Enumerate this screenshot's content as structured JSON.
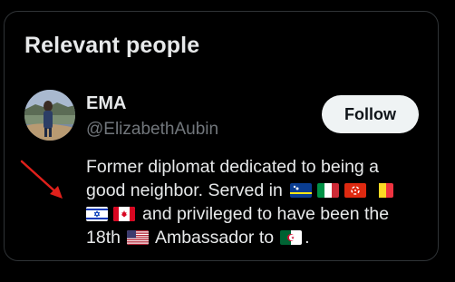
{
  "section": {
    "title": "Relevant people"
  },
  "person": {
    "name": "EMA",
    "handle": "@ElizabethAubin",
    "follow_label": "Follow",
    "avatar_icon": "profile-photo",
    "bio": {
      "line1": "Former diplomat dedicated to being a",
      "line2_text": "good neighbor. Served in",
      "line3_text": "and privileged to have been the",
      "line4_start": "18th",
      "line4_mid": "Ambassador to",
      "line4_end": "."
    },
    "flags": {
      "served_in": [
        "curacao-flag",
        "italy-flag",
        "hong-kong-flag",
        "belgium-flag",
        "israel-flag",
        "canada-flag"
      ],
      "ambassador_country": "us-flag",
      "ambassador_to": "algeria-flag"
    }
  },
  "annotation": {
    "arrow_color": "#e0201b"
  },
  "colors": {
    "background": "#000000",
    "border": "#2f3336",
    "primary_text": "#e7e9ea",
    "secondary_text": "#71767b",
    "button_bg": "#eff3f4",
    "button_text": "#0f1419"
  }
}
